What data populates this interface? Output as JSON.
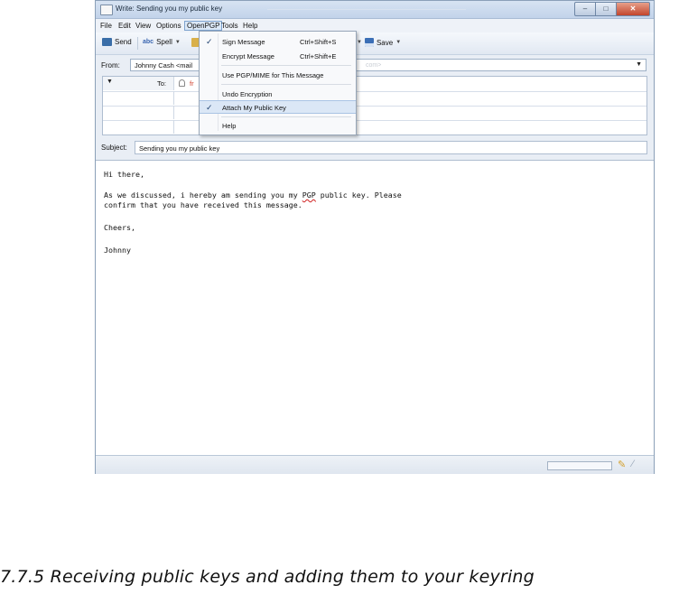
{
  "window": {
    "title": "Write: Sending you my public key",
    "controls": {
      "minimize": "–",
      "maximize": "□",
      "close": "✕"
    }
  },
  "menubar": [
    "File",
    "Edit",
    "View",
    "Options",
    "OpenPGP",
    "Tools",
    "Help"
  ],
  "toolbar": {
    "send": "Send",
    "spell": "Spell",
    "spell_icon_text": "abc",
    "save": "Save"
  },
  "compose": {
    "from_label": "From:",
    "from_value": "Johnny Cash <mail",
    "from_hidden": "com>",
    "recipient_type": "To:",
    "recipient_address": "fr",
    "subject_label": "Subject:",
    "subject_value": "Sending you my public key",
    "body_lines": [
      "Hi there,",
      "",
      "As we discussed, i hereby am sending you my PGP public key. Please",
      "confirm that you have received this message.",
      "",
      "Cheers,",
      "",
      "Johnny"
    ]
  },
  "openpgp_menu": [
    {
      "label": "Sign Message",
      "shortcut": "Ctrl+Shift+S",
      "checked": true
    },
    {
      "label": "Encrypt Message",
      "shortcut": "Ctrl+Shift+E",
      "checked": false
    },
    {
      "label": "Use PGP/MIME for This Message",
      "shortcut": "",
      "checked": false
    },
    {
      "label": "Undo Encryption",
      "shortcut": "",
      "checked": false
    },
    {
      "label": "Attach My Public Key",
      "shortcut": "",
      "checked": true,
      "highlighted": true
    },
    {
      "label": "Help",
      "shortcut": "",
      "checked": false
    }
  ],
  "check_mark": "✓",
  "caption": "7.7.5  Receiving public keys and adding them to your    keyring",
  "colors": {
    "accent": "#dbe7f6",
    "title_bar": "#c2d3ea",
    "recipient_red": "#d0422e"
  }
}
